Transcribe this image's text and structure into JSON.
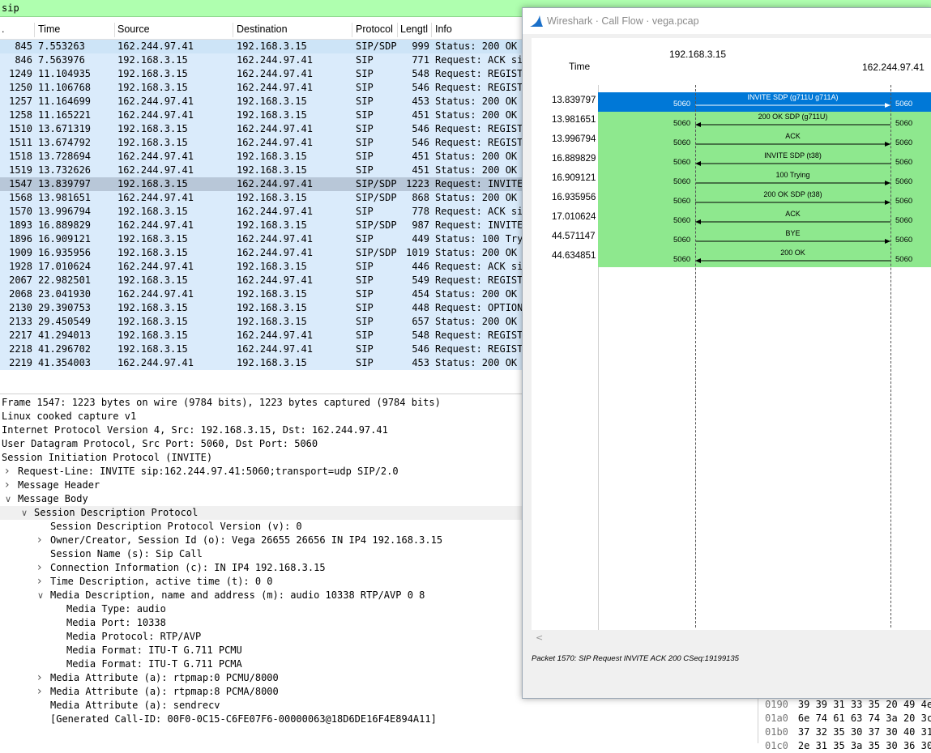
{
  "filter": {
    "value": "sip"
  },
  "packet_list": {
    "columns": [
      ".",
      "Time",
      "Source",
      "Destination",
      "Protocol",
      "Lengtl",
      "Info"
    ],
    "rows": [
      {
        "no": "845",
        "time": "7.553263",
        "src": "162.244.97.41",
        "dst": "192.168.3.15",
        "proto": "SIP/SDP",
        "len": "999",
        "info": "Status: 200 OK ("
      },
      {
        "no": "846",
        "time": "7.563976",
        "src": "192.168.3.15",
        "dst": "162.244.97.41",
        "proto": "SIP",
        "len": "771",
        "info": "Request: ACK sip"
      },
      {
        "no": "1249",
        "time": "11.104935",
        "src": "192.168.3.15",
        "dst": "162.244.97.41",
        "proto": "SIP",
        "len": "548",
        "info": "Request: REGISTE"
      },
      {
        "no": "1250",
        "time": "11.106768",
        "src": "192.168.3.15",
        "dst": "162.244.97.41",
        "proto": "SIP",
        "len": "546",
        "info": "Request: REGISTE"
      },
      {
        "no": "1257",
        "time": "11.164699",
        "src": "162.244.97.41",
        "dst": "192.168.3.15",
        "proto": "SIP",
        "len": "453",
        "info": "Status: 200 OK ("
      },
      {
        "no": "1258",
        "time": "11.165221",
        "src": "162.244.97.41",
        "dst": "192.168.3.15",
        "proto": "SIP",
        "len": "451",
        "info": "Status: 200 OK ("
      },
      {
        "no": "1510",
        "time": "13.671319",
        "src": "192.168.3.15",
        "dst": "162.244.97.41",
        "proto": "SIP",
        "len": "546",
        "info": "Request: REGISTE"
      },
      {
        "no": "1511",
        "time": "13.674792",
        "src": "192.168.3.15",
        "dst": "162.244.97.41",
        "proto": "SIP",
        "len": "546",
        "info": "Request: REGISTE"
      },
      {
        "no": "1518",
        "time": "13.728694",
        "src": "162.244.97.41",
        "dst": "192.168.3.15",
        "proto": "SIP",
        "len": "451",
        "info": "Status: 200 OK ("
      },
      {
        "no": "1519",
        "time": "13.732626",
        "src": "162.244.97.41",
        "dst": "192.168.3.15",
        "proto": "SIP",
        "len": "451",
        "info": "Status: 200 OK ("
      },
      {
        "no": "1547",
        "time": "13.839797",
        "src": "192.168.3.15",
        "dst": "162.244.97.41",
        "proto": "SIP/SDP",
        "len": "1223",
        "info": "Request: INVITE"
      },
      {
        "no": "1568",
        "time": "13.981651",
        "src": "162.244.97.41",
        "dst": "192.168.3.15",
        "proto": "SIP/SDP",
        "len": "868",
        "info": "Status: 200 OK ("
      },
      {
        "no": "1570",
        "time": "13.996794",
        "src": "192.168.3.15",
        "dst": "162.244.97.41",
        "proto": "SIP",
        "len": "778",
        "info": "Request: ACK sip"
      },
      {
        "no": "1893",
        "time": "16.889829",
        "src": "162.244.97.41",
        "dst": "192.168.3.15",
        "proto": "SIP/SDP",
        "len": "987",
        "info": "Request: INVITE"
      },
      {
        "no": "1896",
        "time": "16.909121",
        "src": "192.168.3.15",
        "dst": "162.244.97.41",
        "proto": "SIP",
        "len": "449",
        "info": "Status: 100 Tryi"
      },
      {
        "no": "1909",
        "time": "16.935956",
        "src": "192.168.3.15",
        "dst": "162.244.97.41",
        "proto": "SIP/SDP",
        "len": "1019",
        "info": "Status: 200 OK ("
      },
      {
        "no": "1928",
        "time": "17.010624",
        "src": "162.244.97.41",
        "dst": "192.168.3.15",
        "proto": "SIP",
        "len": "446",
        "info": "Request: ACK sip"
      },
      {
        "no": "2067",
        "time": "22.982501",
        "src": "192.168.3.15",
        "dst": "162.244.97.41",
        "proto": "SIP",
        "len": "549",
        "info": "Request: REGISTE"
      },
      {
        "no": "2068",
        "time": "23.041930",
        "src": "162.244.97.41",
        "dst": "192.168.3.15",
        "proto": "SIP",
        "len": "454",
        "info": "Status: 200 OK ("
      },
      {
        "no": "2130",
        "time": "29.390753",
        "src": "192.168.3.15",
        "dst": "192.168.3.15",
        "proto": "SIP",
        "len": "448",
        "info": "Request: OPTIONS"
      },
      {
        "no": "2133",
        "time": "29.450549",
        "src": "192.168.3.15",
        "dst": "192.168.3.15",
        "proto": "SIP",
        "len": "657",
        "info": "Status: 200 OK ("
      },
      {
        "no": "2217",
        "time": "41.294013",
        "src": "192.168.3.15",
        "dst": "162.244.97.41",
        "proto": "SIP",
        "len": "548",
        "info": "Request: REGISTE"
      },
      {
        "no": "2218",
        "time": "41.296702",
        "src": "192.168.3.15",
        "dst": "162.244.97.41",
        "proto": "SIP",
        "len": "546",
        "info": "Request: REGISTE"
      },
      {
        "no": "2219",
        "time": "41.354003",
        "src": "162.244.97.41",
        "dst": "192.168.3.15",
        "proto": "SIP",
        "len": "453",
        "info": "Status: 200 OK ("
      }
    ]
  },
  "details": [
    {
      "text": "Frame 1547: 1223 bytes on wire (9784 bits), 1223 bytes captured (9784 bits)",
      "indent": 0,
      "arrow": ""
    },
    {
      "text": "Linux cooked capture v1",
      "indent": 0,
      "arrow": ""
    },
    {
      "text": "Internet Protocol Version 4, Src: 192.168.3.15, Dst: 162.244.97.41",
      "indent": 0,
      "arrow": ""
    },
    {
      "text": "User Datagram Protocol, Src Port: 5060, Dst Port: 5060",
      "indent": 0,
      "arrow": ""
    },
    {
      "text": "Session Initiation Protocol (INVITE)",
      "indent": 0,
      "arrow": ""
    },
    {
      "text": "Request-Line: INVITE sip:162.244.97.41:5060;transport=udp SIP/2.0",
      "indent": 1,
      "arrow": "collapsed"
    },
    {
      "text": "Message Header",
      "indent": 1,
      "arrow": "collapsed"
    },
    {
      "text": "Message Body",
      "indent": 1,
      "arrow": "expanded"
    },
    {
      "text": "Session Description Protocol",
      "indent": 2,
      "arrow": "expanded"
    },
    {
      "text": "Session Description Protocol Version (v): 0",
      "indent": 3,
      "arrow": ""
    },
    {
      "text": "Owner/Creator, Session Id (o): Vega 26655 26656 IN IP4 192.168.3.15",
      "indent": 3,
      "arrow": "collapsed"
    },
    {
      "text": "Session Name (s): Sip Call",
      "indent": 3,
      "arrow": ""
    },
    {
      "text": "Connection Information (c): IN IP4 192.168.3.15",
      "indent": 3,
      "arrow": "collapsed"
    },
    {
      "text": "Time Description, active time (t): 0 0",
      "indent": 3,
      "arrow": "collapsed"
    },
    {
      "text": "Media Description, name and address (m): audio 10338 RTP/AVP 0 8",
      "indent": 3,
      "arrow": "expanded"
    },
    {
      "text": "Media Type: audio",
      "indent": 4,
      "arrow": ""
    },
    {
      "text": "Media Port: 10338",
      "indent": 4,
      "arrow": ""
    },
    {
      "text": "Media Protocol: RTP/AVP",
      "indent": 4,
      "arrow": ""
    },
    {
      "text": "Media Format: ITU-T G.711 PCMU",
      "indent": 4,
      "arrow": ""
    },
    {
      "text": "Media Format: ITU-T G.711 PCMA",
      "indent": 4,
      "arrow": ""
    },
    {
      "text": "Media Attribute (a): rtpmap:0 PCMU/8000",
      "indent": 3,
      "arrow": "collapsed"
    },
    {
      "text": "Media Attribute (a): rtpmap:8 PCMA/8000",
      "indent": 3,
      "arrow": "collapsed"
    },
    {
      "text": "Media Attribute (a): sendrecv",
      "indent": 3,
      "arrow": ""
    },
    {
      "text": "[Generated Call-ID: 00F0-0C15-C6FE07F6-00000063@18D6DE16F4E894A11]",
      "indent": 3,
      "arrow": ""
    }
  ],
  "hex": [
    {
      "offset": "0190",
      "bytes": "39 39 31 33 35 20 49 4e"
    },
    {
      "offset": "01a0",
      "bytes": "6e 74 61 63 74 3a 20 3c"
    },
    {
      "offset": "01b0",
      "bytes": "37 32 35 30 37 30 40 31"
    },
    {
      "offset": "01c0",
      "bytes": "2e 31 35 3a 35 30 36 30"
    }
  ],
  "call_flow": {
    "window_title": "Wireshark · Call Flow · vega.pcap",
    "time_header": "Time",
    "host_a": "192.168.3.15",
    "host_b": "162.244.97.41",
    "status": "Packet 1570: SIP Request INVITE ACK 200 CSeq:19199135",
    "flows": [
      {
        "time": "13.839797",
        "label": "INVITE SDP (g711U g711A)",
        "dir": "right",
        "port_a": "5060",
        "port_b": "5060",
        "selected": true
      },
      {
        "time": "13.981651",
        "label": "200 OK SDP (g711U)",
        "dir": "left",
        "port_a": "5060",
        "port_b": "5060",
        "selected": false
      },
      {
        "time": "13.996794",
        "label": "ACK",
        "dir": "right",
        "port_a": "5060",
        "port_b": "5060",
        "selected": false
      },
      {
        "time": "16.889829",
        "label": "INVITE SDP (t38)",
        "dir": "left",
        "port_a": "5060",
        "port_b": "5060",
        "selected": false
      },
      {
        "time": "16.909121",
        "label": "100 Trying",
        "dir": "right",
        "port_a": "5060",
        "port_b": "5060",
        "selected": false
      },
      {
        "time": "16.935956",
        "label": "200 OK SDP (t38)",
        "dir": "right",
        "port_a": "5060",
        "port_b": "5060",
        "selected": false
      },
      {
        "time": "17.010624",
        "label": "ACK",
        "dir": "left",
        "port_a": "5060",
        "port_b": "5060",
        "selected": false
      },
      {
        "time": "44.571147",
        "label": "BYE",
        "dir": "right",
        "port_a": "5060",
        "port_b": "5060",
        "selected": false
      },
      {
        "time": "44.634851",
        "label": "200 OK",
        "dir": "left",
        "port_a": "5060",
        "port_b": "5060",
        "selected": false
      }
    ]
  }
}
